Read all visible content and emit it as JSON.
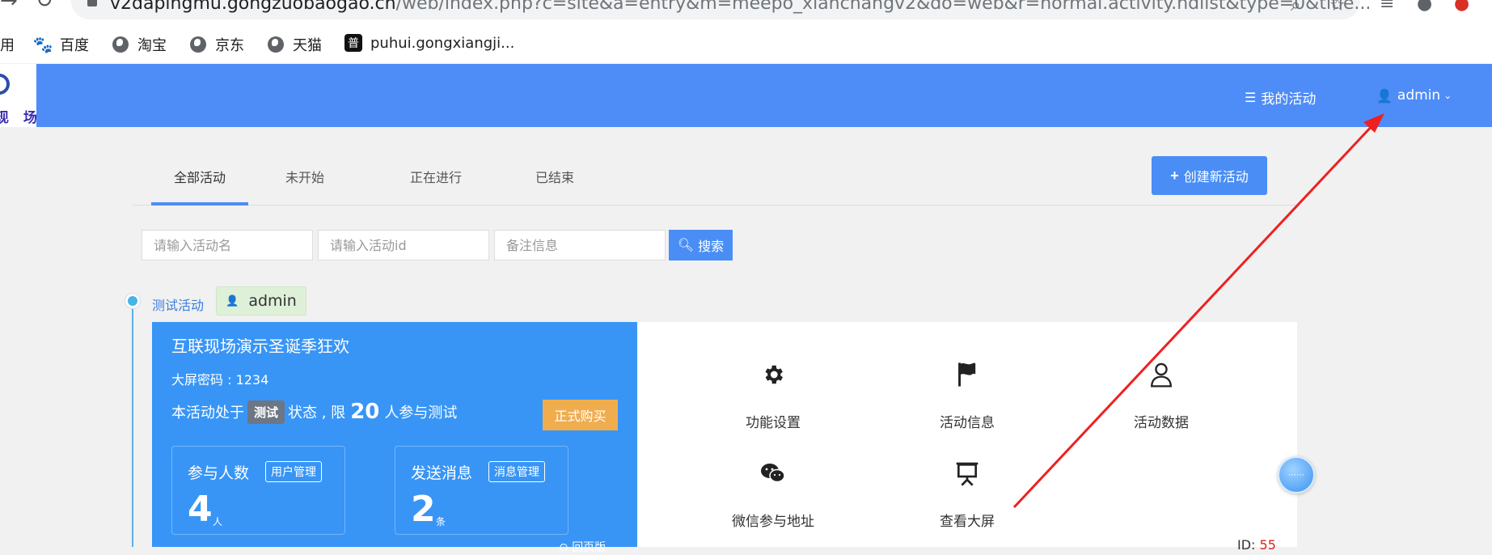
{
  "browser": {
    "url_host": "v2dapingmu.gongzuobaogao.cn",
    "url_path": "/web/index.php?c=site&a=entry&m=meepo_xianchangv2&do=web&r=normal.activity.hdlist&type=0&title...",
    "bookmarks": [
      {
        "label": "用",
        "icon": "apps-icon"
      },
      {
        "label": "百度",
        "icon": "paw-icon"
      },
      {
        "label": "淘宝",
        "icon": "globe-icon"
      },
      {
        "label": "京东",
        "icon": "globe-icon"
      },
      {
        "label": "天猫",
        "icon": "globe-icon"
      },
      {
        "label": "puhui.gongxiangji...",
        "icon": "pu-icon",
        "icon_text": "普"
      }
    ]
  },
  "header": {
    "logo_text": "现 场",
    "my_activities": "我的活动",
    "user": "admin"
  },
  "tabs": [
    {
      "label": "全部活动",
      "active": true
    },
    {
      "label": "未开始",
      "active": false
    },
    {
      "label": "正在进行",
      "active": false
    },
    {
      "label": "已结束",
      "active": false
    }
  ],
  "create_button": "创建新活动",
  "search": {
    "name_placeholder": "请输入活动名",
    "id_placeholder": "请输入活动id",
    "note_placeholder": "备注信息",
    "button": "搜索"
  },
  "activity": {
    "group_name": "测试活动",
    "owner": "admin",
    "title": "互联现场演示圣诞季狂欢",
    "screen_password": "大屏密码 : 1234",
    "status_prefix": "本活动处于",
    "status_badge": "测试",
    "status_mid": "状态 , 限",
    "limit": "20",
    "status_suffix": "人参与测试",
    "buy_button": "正式购买",
    "participants": {
      "label": "参与人数",
      "tag": "用户管理",
      "value": "4",
      "unit": "人"
    },
    "messages": {
      "label": "发送消息",
      "tag": "消息管理",
      "value": "2",
      "unit": "条"
    },
    "version_link": "回页版",
    "id_label": "ID:",
    "id_value": "55",
    "functions": [
      {
        "label": "功能设置",
        "icon": "gear-icon"
      },
      {
        "label": "活动信息",
        "icon": "flag-icon"
      },
      {
        "label": "活动数据",
        "icon": "user-icon"
      },
      {
        "label": "微信参与地址",
        "icon": "wechat-icon"
      },
      {
        "label": "查看大屏",
        "icon": "presentation-icon"
      }
    ]
  },
  "colors": {
    "header_blue": "#4e8cf7",
    "card_blue": "#3895f6",
    "buy_orange": "#f0ad4e",
    "arrow_red": "#ee2020"
  }
}
